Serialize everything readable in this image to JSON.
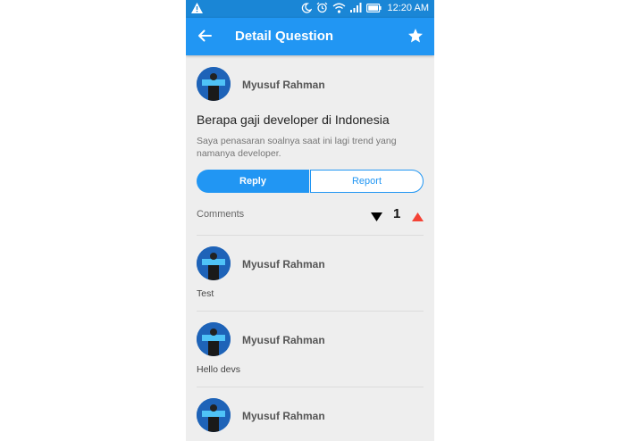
{
  "status_bar": {
    "time": "12:20 AM"
  },
  "app_bar": {
    "title": "Detail Question",
    "back_icon": "arrow-left-icon",
    "star_icon": "star-icon"
  },
  "question": {
    "author": "Myusuf Rahman",
    "title": "Berapa gaji developer di Indonesia",
    "body": "Saya penasaran soalnya saat ini lagi trend yang namanya developer."
  },
  "actions": {
    "reply_label": "Reply",
    "report_label": "Report"
  },
  "comments_section": {
    "label": "Comments",
    "vote_count": "1",
    "down_color": "#000000",
    "up_color": "#f44336"
  },
  "comments": [
    {
      "author": "Myusuf Rahman",
      "text": "Test"
    },
    {
      "author": "Myusuf Rahman",
      "text": "Hello devs"
    },
    {
      "author": "Myusuf Rahman",
      "text": ""
    }
  ],
  "colors": {
    "primary": "#2196f3",
    "status_bar": "#1a86d6",
    "background": "#eeeeee"
  }
}
